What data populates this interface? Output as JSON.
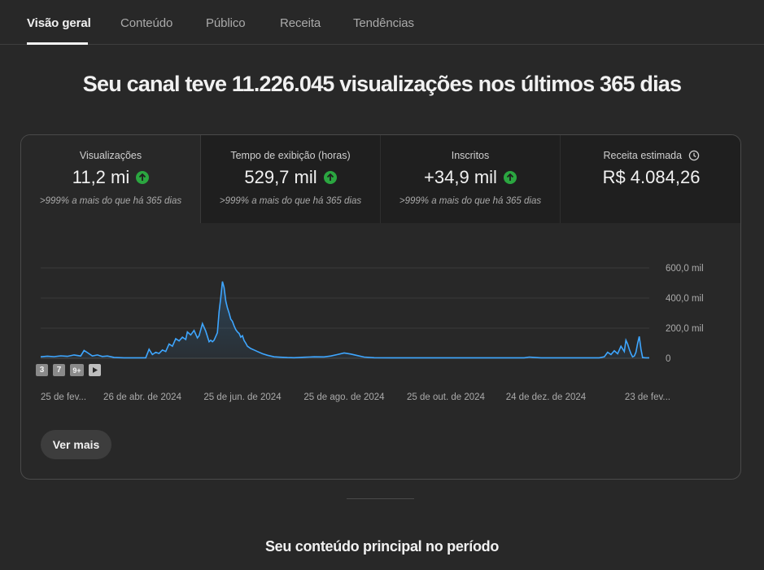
{
  "tabs": [
    {
      "label": "Visão geral",
      "active": true
    },
    {
      "label": "Conteúdo",
      "active": false
    },
    {
      "label": "Público",
      "active": false
    },
    {
      "label": "Receita",
      "active": false
    },
    {
      "label": "Tendências",
      "active": false
    }
  ],
  "headline": "Seu canal teve 11.226.045 visualizações nos últimos 365 dias",
  "metrics": [
    {
      "label": "Visualizações",
      "value": "11,2 mi",
      "trend": "up",
      "comparison": ">999% a mais do que há 365 dias"
    },
    {
      "label": "Tempo de exibição (horas)",
      "value": "529,7 mil",
      "trend": "up",
      "comparison": ">999% a mais do que há 365 dias"
    },
    {
      "label": "Inscritos",
      "value": "+34,9 mil",
      "trend": "up",
      "comparison": ">999% a mais do que há 365 dias"
    },
    {
      "label": "Receita estimada",
      "value": "R$ 4.084,26",
      "icon": "clock-icon"
    }
  ],
  "colors": {
    "accent_line": "#3ea6ff",
    "trend_up": "#2ba640",
    "background": "#282828"
  },
  "chart_data": {
    "type": "area",
    "ylim": [
      0,
      600000
    ],
    "yticks": [
      {
        "value": 0,
        "label": "0"
      },
      {
        "value": 200000,
        "label": "200,0 mil"
      },
      {
        "value": 400000,
        "label": "400,0 mil"
      },
      {
        "value": 600000,
        "label": "600,0 mil"
      }
    ],
    "xlim": [
      0,
      365
    ],
    "xticks": [
      {
        "value": 0,
        "label": "25 de fev..."
      },
      {
        "value": 61,
        "label": "26 de abr. de 2024"
      },
      {
        "value": 121,
        "label": "25 de jun. de 2024"
      },
      {
        "value": 182,
        "label": "25 de ago. de 2024"
      },
      {
        "value": 243,
        "label": "25 de out. de 2024"
      },
      {
        "value": 303,
        "label": "24 de dez. de 2024"
      },
      {
        "value": 364,
        "label": "23 de fev..."
      }
    ],
    "series": [
      {
        "points": [
          [
            0,
            10000
          ],
          [
            4,
            14000
          ],
          [
            8,
            11000
          ],
          [
            12,
            16000
          ],
          [
            16,
            13000
          ],
          [
            20,
            22000
          ],
          [
            24,
            15000
          ],
          [
            26,
            52000
          ],
          [
            28,
            38000
          ],
          [
            31,
            15000
          ],
          [
            34,
            22000
          ],
          [
            37,
            12000
          ],
          [
            40,
            15000
          ],
          [
            44,
            6000
          ],
          [
            50,
            3000
          ],
          [
            58,
            3000
          ],
          [
            63,
            3000
          ],
          [
            65,
            60000
          ],
          [
            67,
            25000
          ],
          [
            69,
            40000
          ],
          [
            71,
            32000
          ],
          [
            73,
            55000
          ],
          [
            75,
            45000
          ],
          [
            77,
            95000
          ],
          [
            79,
            80000
          ],
          [
            81,
            130000
          ],
          [
            83,
            115000
          ],
          [
            85,
            140000
          ],
          [
            87,
            125000
          ],
          [
            88,
            175000
          ],
          [
            90,
            155000
          ],
          [
            92,
            185000
          ],
          [
            94,
            135000
          ],
          [
            95,
            150000
          ],
          [
            97,
            230000
          ],
          [
            99,
            180000
          ],
          [
            101,
            110000
          ],
          [
            102,
            120000
          ],
          [
            103,
            110000
          ],
          [
            104,
            120000
          ],
          [
            106,
            170000
          ],
          [
            107,
            310000
          ],
          [
            108,
            400000
          ],
          [
            109,
            510000
          ],
          [
            110,
            470000
          ],
          [
            111,
            380000
          ],
          [
            112,
            335000
          ],
          [
            113,
            300000
          ],
          [
            114,
            260000
          ],
          [
            115,
            245000
          ],
          [
            116,
            215000
          ],
          [
            117,
            190000
          ],
          [
            118,
            175000
          ],
          [
            119,
            165000
          ],
          [
            120,
            140000
          ],
          [
            121,
            150000
          ],
          [
            122,
            118000
          ],
          [
            123,
            100000
          ],
          [
            124,
            80000
          ],
          [
            126,
            65000
          ],
          [
            128,
            55000
          ],
          [
            130,
            45000
          ],
          [
            133,
            30000
          ],
          [
            136,
            20000
          ],
          [
            140,
            10000
          ],
          [
            144,
            7000
          ],
          [
            148,
            5000
          ],
          [
            152,
            4000
          ],
          [
            158,
            7000
          ],
          [
            164,
            10000
          ],
          [
            170,
            9000
          ],
          [
            174,
            15000
          ],
          [
            178,
            25000
          ],
          [
            182,
            35000
          ],
          [
            186,
            28000
          ],
          [
            190,
            18000
          ],
          [
            194,
            8000
          ],
          [
            200,
            4000
          ],
          [
            210,
            3000
          ],
          [
            230,
            3000
          ],
          [
            250,
            3000
          ],
          [
            270,
            3000
          ],
          [
            290,
            3000
          ],
          [
            293,
            8000
          ],
          [
            296,
            6000
          ],
          [
            300,
            3000
          ],
          [
            310,
            3000
          ],
          [
            320,
            3000
          ],
          [
            335,
            3000
          ],
          [
            338,
            10000
          ],
          [
            340,
            40000
          ],
          [
            342,
            25000
          ],
          [
            344,
            50000
          ],
          [
            346,
            30000
          ],
          [
            348,
            80000
          ],
          [
            350,
            45000
          ],
          [
            351,
            120000
          ],
          [
            352,
            95000
          ],
          [
            353,
            60000
          ],
          [
            354,
            30000
          ],
          [
            355,
            10000
          ],
          [
            356,
            15000
          ],
          [
            357,
            40000
          ],
          [
            358,
            100000
          ],
          [
            359,
            145000
          ],
          [
            360,
            60000
          ],
          [
            361,
            5000
          ],
          [
            363,
            3000
          ],
          [
            365,
            3000
          ]
        ]
      }
    ]
  },
  "zoom_badges": [
    "3",
    "7",
    "9+"
  ],
  "see_more_label": "Ver mais",
  "section_title": "Seu conteúdo principal no período"
}
